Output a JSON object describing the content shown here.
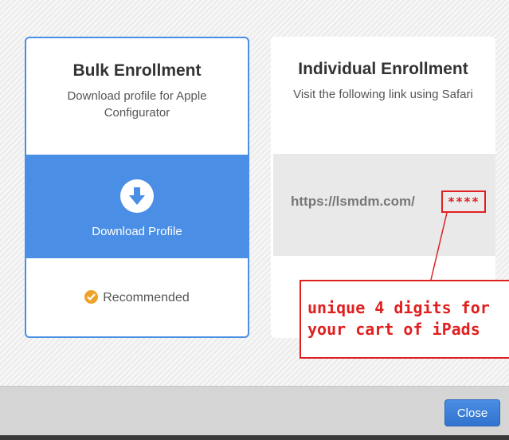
{
  "bulk": {
    "title": "Bulk Enrollment",
    "description": "Download profile for Apple Configurator",
    "download_label": "Download Profile",
    "recommended_label": "Recommended"
  },
  "individual": {
    "title": "Individual Enrollment",
    "description": "Visit the following link using Safari",
    "link": "https://lsmdm.com/",
    "masked_code": "****"
  },
  "annotation": {
    "line1": "unique 4 digits for",
    "line2": "your cart of iPads"
  },
  "footer": {
    "close_label": "Close"
  },
  "icons": {
    "download": "download-arrow-icon",
    "recommended": "checkmark-icon"
  },
  "colors": {
    "accent": "#4a8ee6",
    "annotation_red": "#e02020",
    "recommended_orange": "#f0a127"
  }
}
